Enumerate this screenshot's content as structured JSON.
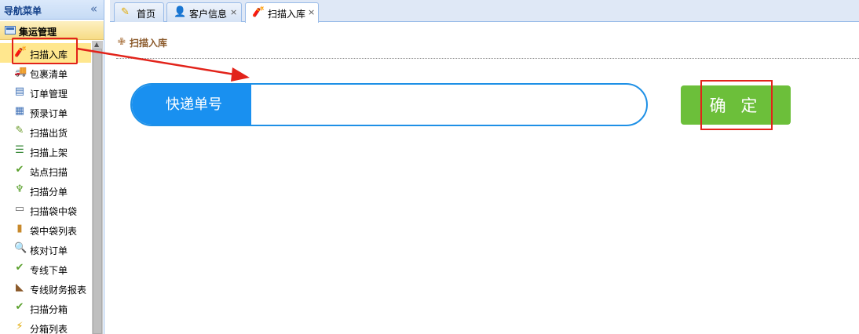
{
  "sidebar": {
    "title": "导航菜单",
    "collapse_icon": "«",
    "group_label": "集运管理",
    "items": [
      {
        "label": "扫描入库",
        "icon": "🧨",
        "color": "#c0392b",
        "active": true
      },
      {
        "label": "包裹清单",
        "icon": "🚚",
        "color": "#555"
      },
      {
        "label": "订单管理",
        "icon": "▤",
        "color": "#3d6fb6"
      },
      {
        "label": "预录订单",
        "icon": "▦",
        "color": "#3d6fb6"
      },
      {
        "label": "扫描出货",
        "icon": "✎",
        "color": "#6a9a2a"
      },
      {
        "label": "扫描上架",
        "icon": "☰",
        "color": "#3a8a3a"
      },
      {
        "label": "站点扫描",
        "icon": "✔",
        "color": "#5aa02c"
      },
      {
        "label": "扫描分单",
        "icon": "♆",
        "color": "#5aa02c"
      },
      {
        "label": "扫描袋中袋",
        "icon": "▭",
        "color": "#666"
      },
      {
        "label": "袋中袋列表",
        "icon": "▮",
        "color": "#c8892b"
      },
      {
        "label": "核对订单",
        "icon": "🔍",
        "color": "#555"
      },
      {
        "label": "专线下单",
        "icon": "✔",
        "color": "#5aa02c"
      },
      {
        "label": "专线财务报表",
        "icon": "◣",
        "color": "#8b5a2b"
      },
      {
        "label": "扫描分箱",
        "icon": "✔",
        "color": "#5aa02c"
      },
      {
        "label": "分箱列表",
        "icon": "⚡",
        "color": "#e0a800"
      }
    ]
  },
  "tabs": [
    {
      "label": "首页",
      "icon": "✎",
      "closable": false
    },
    {
      "label": "客户信息",
      "icon": "👤",
      "closable": true
    },
    {
      "label": "扫描入库",
      "icon": "🧨",
      "closable": true,
      "active": true
    }
  ],
  "close_glyph": "×",
  "breadcrumb": {
    "label": "扫描入库",
    "icon": "✙"
  },
  "form": {
    "field_label": "快递单号",
    "field_value": "",
    "confirm_label": "确 定"
  },
  "colors": {
    "accent_blue": "#1990f0",
    "confirm_green": "#6cbf3a",
    "highlight_red": "#e2231a"
  }
}
